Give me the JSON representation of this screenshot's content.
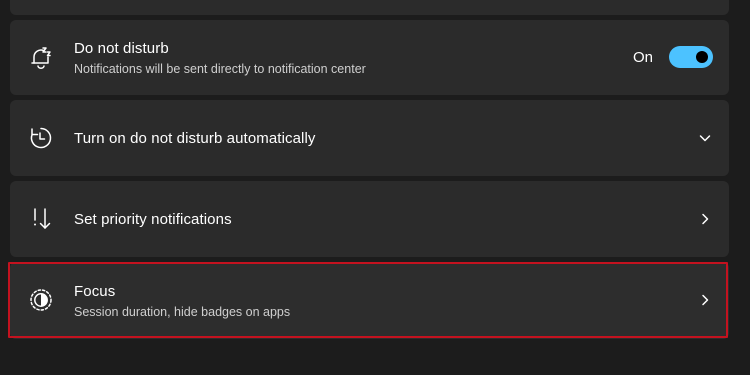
{
  "settings": {
    "dnd": {
      "title": "Do not disturb",
      "subtitle": "Notifications will be sent directly to notification center",
      "state_label": "On",
      "icon": "bell-snooze-icon",
      "toggle_on": true
    },
    "auto": {
      "title": "Turn on do not disturb automatically",
      "icon": "clock-refresh-icon",
      "chevron": "chevron-down-icon"
    },
    "priority": {
      "title": "Set priority notifications",
      "icon": "priority-sort-icon",
      "chevron": "chevron-right-icon"
    },
    "focus": {
      "title": "Focus",
      "subtitle": "Session duration, hide badges on apps",
      "icon": "focus-icon",
      "chevron": "chevron-right-icon"
    }
  },
  "colors": {
    "background": "#1c1c1c",
    "card": "#2b2b2b",
    "accent": "#4cc2ff",
    "highlight": "#c4121f"
  }
}
